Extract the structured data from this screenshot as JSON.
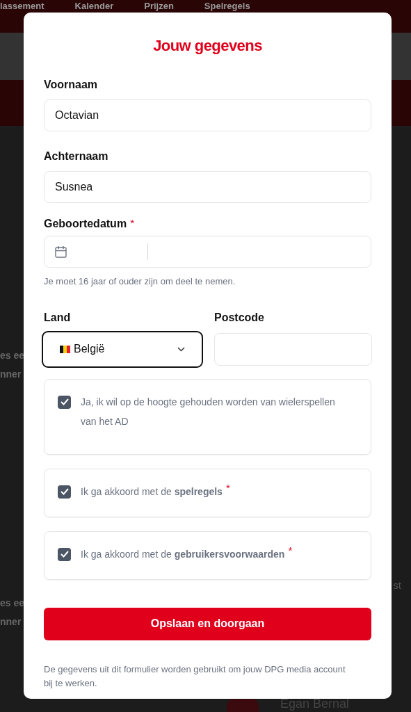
{
  "background": {
    "nav_items": [
      "lassement",
      "Kalender",
      "Prijzen",
      "Spelregels"
    ],
    "left_fragments": [
      "es ee",
      "nner",
      "es ee",
      "nner"
    ],
    "right_fragment": "st",
    "rider_name": "Egan Bernal"
  },
  "dialog": {
    "title": "Jouw gegevens",
    "fields": [
      {
        "label": "Voornaam",
        "value": "Octavian"
      },
      {
        "label": "Achternaam",
        "value": "Susnea"
      }
    ],
    "birthdate": {
      "label": "Geboortedatum",
      "required_mark": "*",
      "hint": "Je moet 16 jaar of ouder zijn om deel te nemen."
    },
    "country": {
      "label": "Land",
      "value": "België",
      "focused": true
    },
    "postcode": {
      "label": "Postcode"
    },
    "consents": [
      {
        "text": "Ja, ik wil op de hoogte gehouden worden van wielerspellen van het AD",
        "checked": true
      },
      {
        "text": "Ik ga akkoord met de **spelregels**",
        "required_mark": "*",
        "checked": true
      },
      {
        "text": "Ik ga akkoord met de **gebruikersvoorwaarden**",
        "required_mark": "*",
        "checked": true
      }
    ],
    "submit": "Opslaan en doorgaan",
    "footer": "De gegevens uit dit formulier worden gebruikt om jouw DPG media account bij te werken."
  }
}
